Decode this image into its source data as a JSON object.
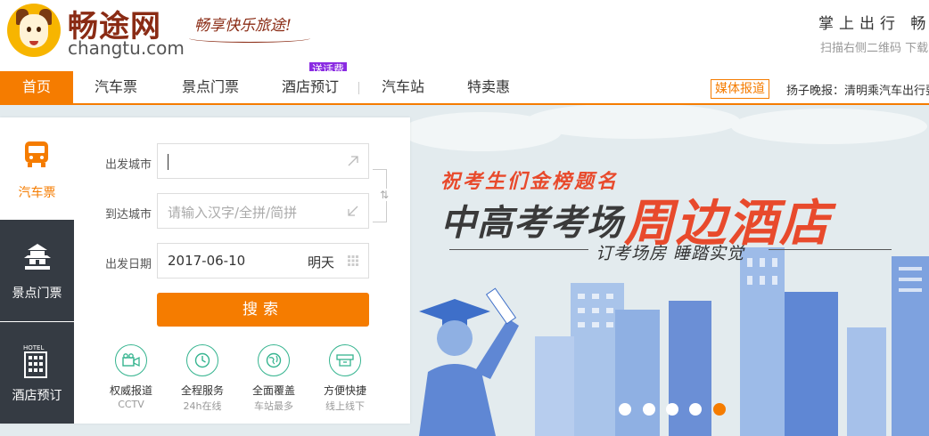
{
  "header": {
    "brand_cn": "畅途网",
    "brand_en": "changtu.com",
    "slogan": "畅享快乐旅途!",
    "mobile_title": "掌上出行 畅途",
    "mobile_sub": "扫描右侧二维码 下载"
  },
  "nav": {
    "items": [
      "首页",
      "汽车票",
      "景点门票",
      "酒店预订",
      "汽车站",
      "特卖惠"
    ],
    "badge": "送话费",
    "media_tag": "媒体报道",
    "news": "扬子晚报：清明乘汽车出行要提"
  },
  "side_tabs": [
    "汽车票",
    "景点门票",
    "酒店预订"
  ],
  "form": {
    "from_label": "出发城市",
    "from_value": "",
    "to_label": "到达城市",
    "to_placeholder": "请输入汉字/全拼/简拼",
    "date_label": "出发日期",
    "date_value": "2017-06-10",
    "date_day": "明天",
    "search_label": "搜索"
  },
  "features": [
    {
      "title": "权威报道",
      "sub": "CCTV",
      "icon": "tv-camera-icon"
    },
    {
      "title": "全程服务",
      "sub": "24h在线",
      "icon": "clock-icon"
    },
    {
      "title": "全面覆盖",
      "sub": "车站最多",
      "icon": "globe-icon"
    },
    {
      "title": "方便快捷",
      "sub": "线上线下",
      "icon": "ticket-icon"
    }
  ],
  "banner": {
    "line1": "祝考生们金榜题名",
    "line2a": "中高考考场",
    "line2b": "周边酒店",
    "sub": "订考场房 睡踏实觉",
    "slide_count": 5,
    "active_slide": 5
  },
  "colors": {
    "accent": "#f57c00",
    "brand": "#8a2b14",
    "dark_tab": "#353b43",
    "feature_green": "#35b48f",
    "banner_red": "#e84a2c"
  }
}
